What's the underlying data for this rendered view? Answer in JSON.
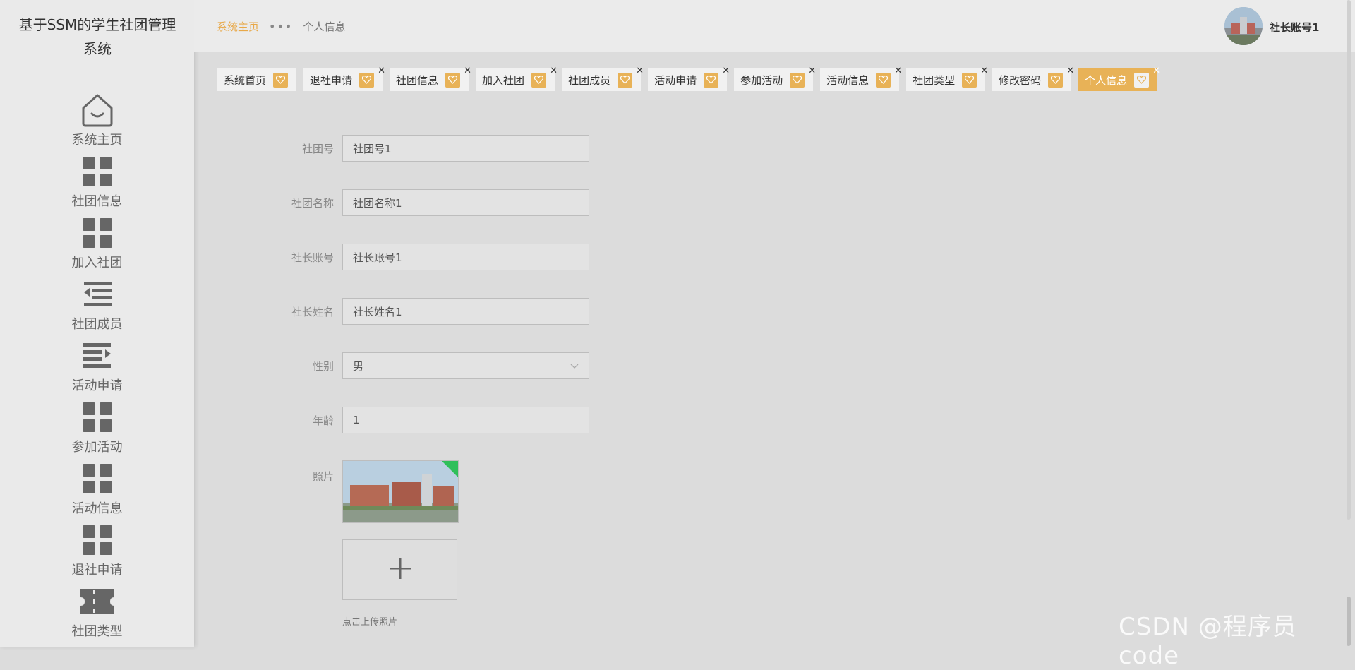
{
  "sidebar": {
    "title": "基于SSM的学生社团管理系统",
    "items": [
      {
        "label": "系统主页",
        "icon": "home-icon"
      },
      {
        "label": "社团信息",
        "icon": "grid-icon"
      },
      {
        "label": "加入社团",
        "icon": "grid-icon"
      },
      {
        "label": "社团成员",
        "icon": "indent-icon"
      },
      {
        "label": "活动申请",
        "icon": "outdent-icon"
      },
      {
        "label": "参加活动",
        "icon": "grid-icon"
      },
      {
        "label": "活动信息",
        "icon": "grid-icon"
      },
      {
        "label": "退社申请",
        "icon": "grid-icon"
      },
      {
        "label": "社团类型",
        "icon": "ticket-icon"
      }
    ]
  },
  "header": {
    "breadcrumb_home": "系统主页",
    "breadcrumb_sep": "•••",
    "breadcrumb_current": "个人信息",
    "user_name": "社长账号1"
  },
  "tabs": [
    {
      "label": "系统首页",
      "closable": false,
      "active": false
    },
    {
      "label": "退社申请",
      "closable": true,
      "active": false
    },
    {
      "label": "社团信息",
      "closable": true,
      "active": false
    },
    {
      "label": "加入社团",
      "closable": true,
      "active": false
    },
    {
      "label": "社团成员",
      "closable": true,
      "active": false
    },
    {
      "label": "活动申请",
      "closable": true,
      "active": false
    },
    {
      "label": "参加活动",
      "closable": true,
      "active": false
    },
    {
      "label": "活动信息",
      "closable": true,
      "active": false
    },
    {
      "label": "社团类型",
      "closable": true,
      "active": false
    },
    {
      "label": "修改密码",
      "closable": true,
      "active": false
    },
    {
      "label": "个人信息",
      "closable": true,
      "active": true
    }
  ],
  "form": {
    "fields": [
      {
        "label": "社团号",
        "value": "社团号1"
      },
      {
        "label": "社团名称",
        "value": "社团名称1"
      },
      {
        "label": "社长账号",
        "value": "社长账号1"
      },
      {
        "label": "社长姓名",
        "value": "社长姓名1"
      },
      {
        "label": "性别",
        "value": "男",
        "type": "select"
      },
      {
        "label": "年龄",
        "value": "1"
      }
    ],
    "photo_label": "照片",
    "upload_tip": "点击上传照片"
  },
  "watermark": "CSDN @程序员code",
  "colors": {
    "accent": "#e8b257",
    "sidebar_bg": "#eaeaea",
    "content_bg": "#dcdcdc"
  }
}
